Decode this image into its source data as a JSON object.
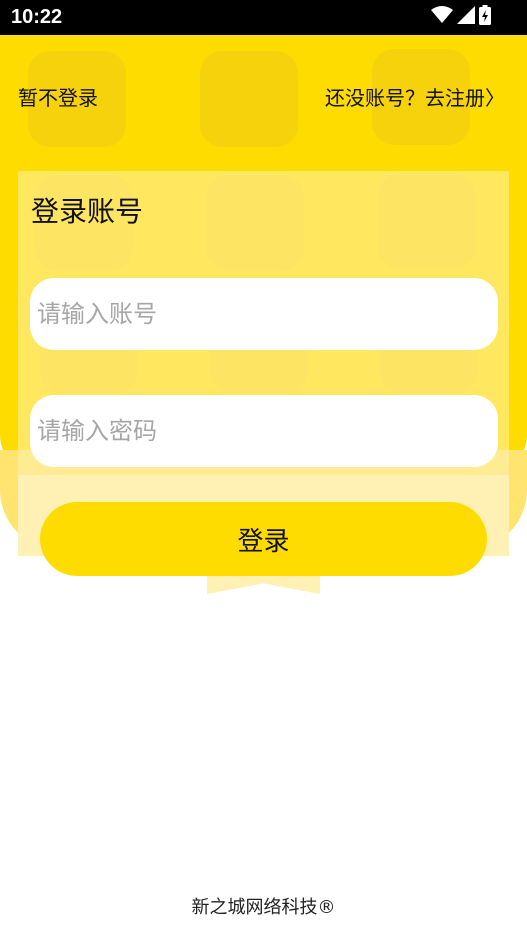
{
  "status_bar": {
    "time": "10:22",
    "icons": [
      "wifi-icon",
      "cell-signal-icon",
      "battery-icon"
    ]
  },
  "header": {
    "skip_label": "暂不登录",
    "register_link": "还没账号？去注册〉"
  },
  "login_card": {
    "title": "登录账号",
    "account_placeholder": "请输入账号",
    "password_placeholder": "请输入密码",
    "login_button": "登录"
  },
  "footer": {
    "company": "新之城网络科技®"
  },
  "colors": {
    "brand_yellow": "#ffdc00",
    "card_yellow": "#fff0b4",
    "status_bar": "#000000"
  }
}
